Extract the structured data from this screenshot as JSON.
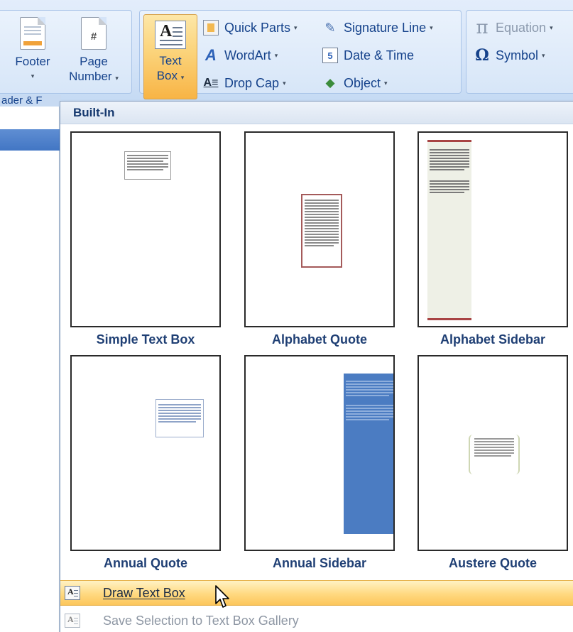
{
  "ribbon": {
    "header_footer_group_label": "ader & F",
    "footer": {
      "label": "Footer",
      "caret": "▾"
    },
    "page_number": {
      "line1": "Page",
      "line2": "Number",
      "caret": "▾"
    },
    "text_box": {
      "line1": "Text",
      "line2": "Box",
      "caret": "▾"
    },
    "quick_parts": {
      "label": "Quick Parts",
      "caret": "▾"
    },
    "wordart": {
      "label": "WordArt",
      "caret": "▾"
    },
    "drop_cap": {
      "label": "Drop Cap",
      "caret": "▾",
      "icon_glyph": "A≡"
    },
    "signature_line": {
      "label": "Signature Line",
      "caret": "▾"
    },
    "date_time": {
      "label": "Date & Time",
      "icon_glyph": "5"
    },
    "object": {
      "label": "Object",
      "caret": "▾"
    },
    "equation": {
      "label": "Equation",
      "caret": "▾",
      "icon_glyph": "π",
      "enabled": false
    },
    "symbol": {
      "label": "Symbol",
      "caret": "▾",
      "icon_glyph": "Ω"
    }
  },
  "gallery": {
    "section_header": "Built-In",
    "items": [
      {
        "caption": "Simple Text Box"
      },
      {
        "caption": "Alphabet Quote"
      },
      {
        "caption": "Alphabet Sidebar"
      },
      {
        "caption": "Annual Quote"
      },
      {
        "caption": "Annual Sidebar"
      },
      {
        "caption": "Austere Quote"
      }
    ]
  },
  "commands": {
    "draw_text_box": {
      "label": "Draw Text Box",
      "highlighted": true
    },
    "save_selection": {
      "label": "Save Selection to Text Box Gallery",
      "enabled": false
    }
  },
  "colors": {
    "ribbon_bg": "#d5e4f8",
    "ribbon_text": "#15428b",
    "active_button": "#fbd37a",
    "caption_text": "#1f3f74",
    "annual_sidebar_blue": "#4b7cc2",
    "alphabet_accent": "#a84444"
  }
}
